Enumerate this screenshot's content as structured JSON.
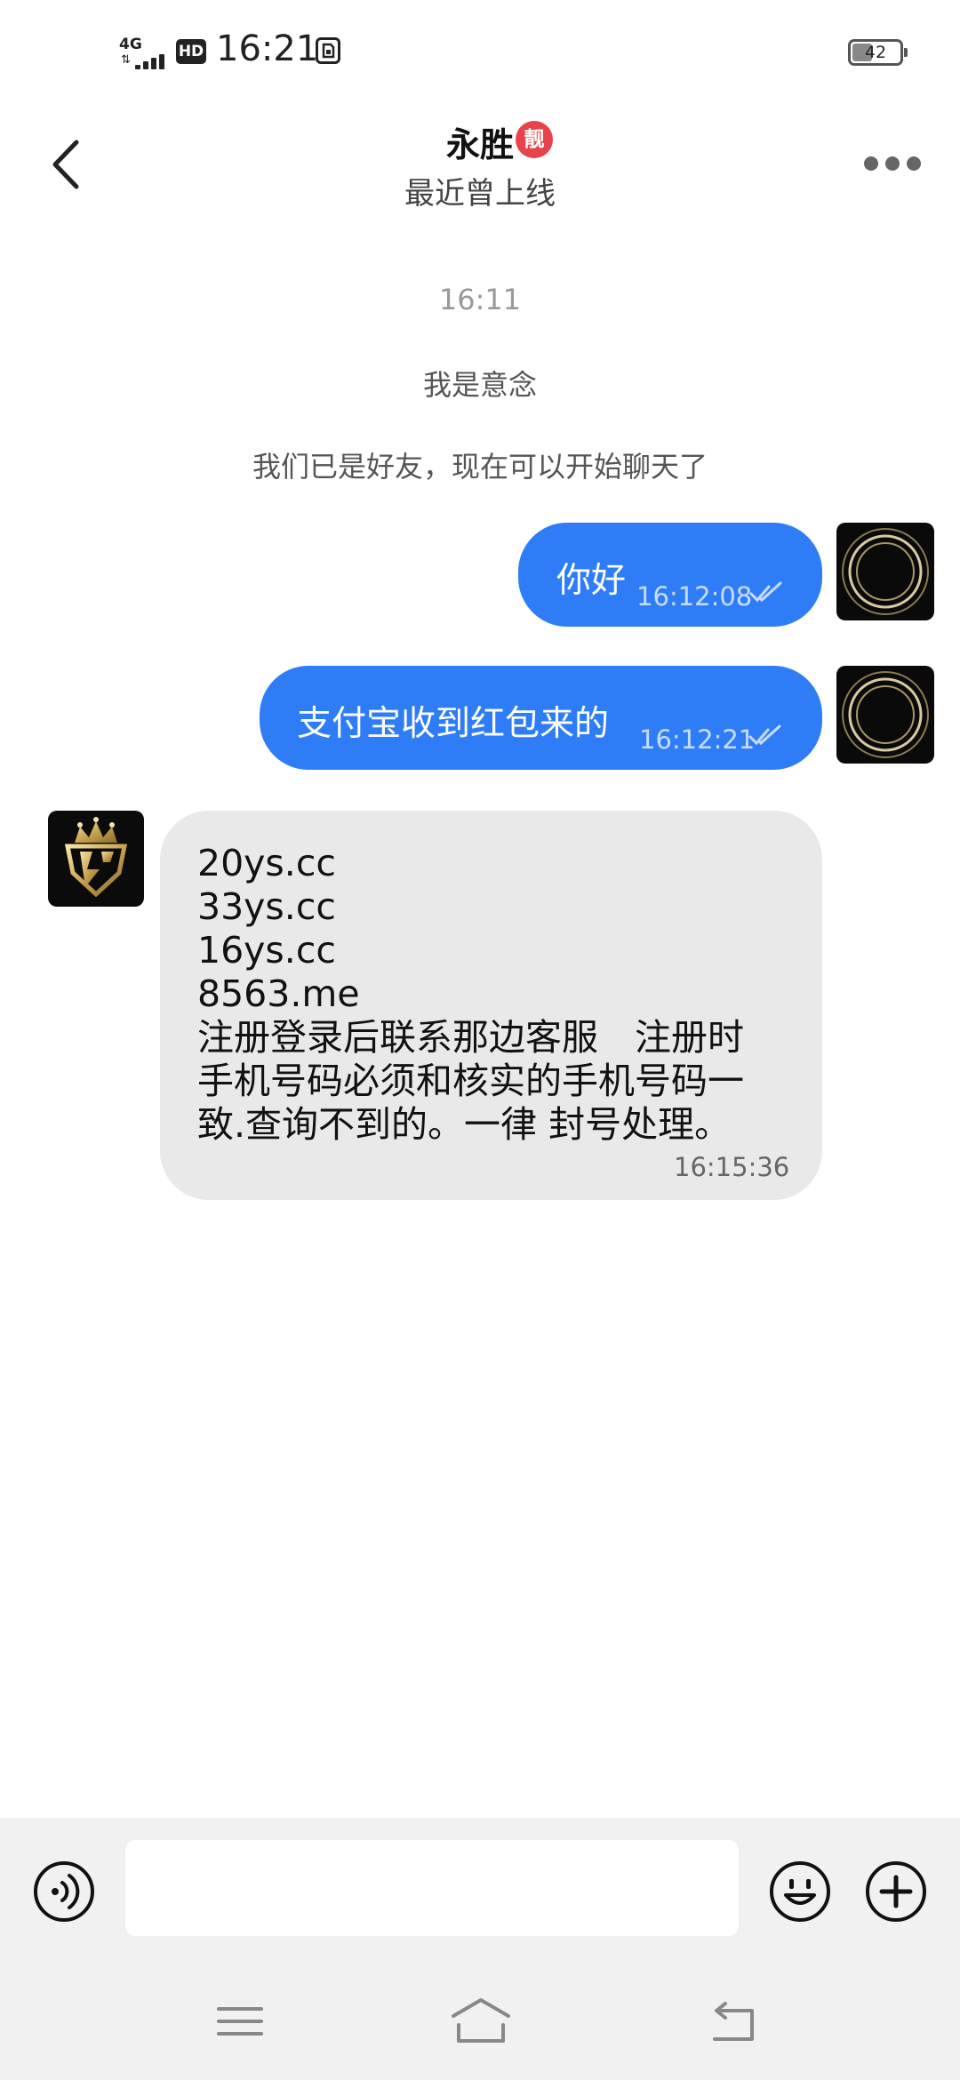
{
  "status_bar": {
    "network": "4G",
    "hd_label": "HD",
    "time": "16:21",
    "battery_level": "42",
    "icons": [
      "signal-icon",
      "hd-icon",
      "sim-icon",
      "battery-icon"
    ]
  },
  "header": {
    "contact_name": "永胜",
    "badge": "靓",
    "presence": "最近曾上线",
    "icons": [
      "back-icon",
      "more-icon"
    ]
  },
  "conversation": {
    "timestamp": "16:11",
    "system_messages": [
      "我是意念",
      "我们已是好友，现在可以开始聊天了"
    ],
    "messages": [
      {
        "direction": "outgoing",
        "text": "你好",
        "time": "16:12:08",
        "status": "read"
      },
      {
        "direction": "outgoing",
        "text": "支付宝收到红包来的",
        "time": "16:12:21",
        "status": "read"
      },
      {
        "direction": "incoming",
        "lines": [
          "20ys.cc",
          "33ys.cc",
          "16ys.cc",
          "8563.me",
          "注册登录后联系那边客服　注册时",
          "手机号码必须和核实的手机号码一",
          "致.查询不到的。一律 封号处理。"
        ],
        "time": "16:15:36"
      }
    ]
  },
  "input_bar": {
    "value": "",
    "icons": [
      "voice-icon",
      "emoji-icon",
      "plus-icon"
    ]
  },
  "colors": {
    "outgoing_bubble": "#2f7df6",
    "incoming_bubble": "#e9e9e9",
    "badge": "#e8434a",
    "bar_background": "#f1f1f1"
  },
  "nav_bar": {
    "icons": [
      "menu-icon",
      "home-icon",
      "back-nav-icon"
    ]
  }
}
